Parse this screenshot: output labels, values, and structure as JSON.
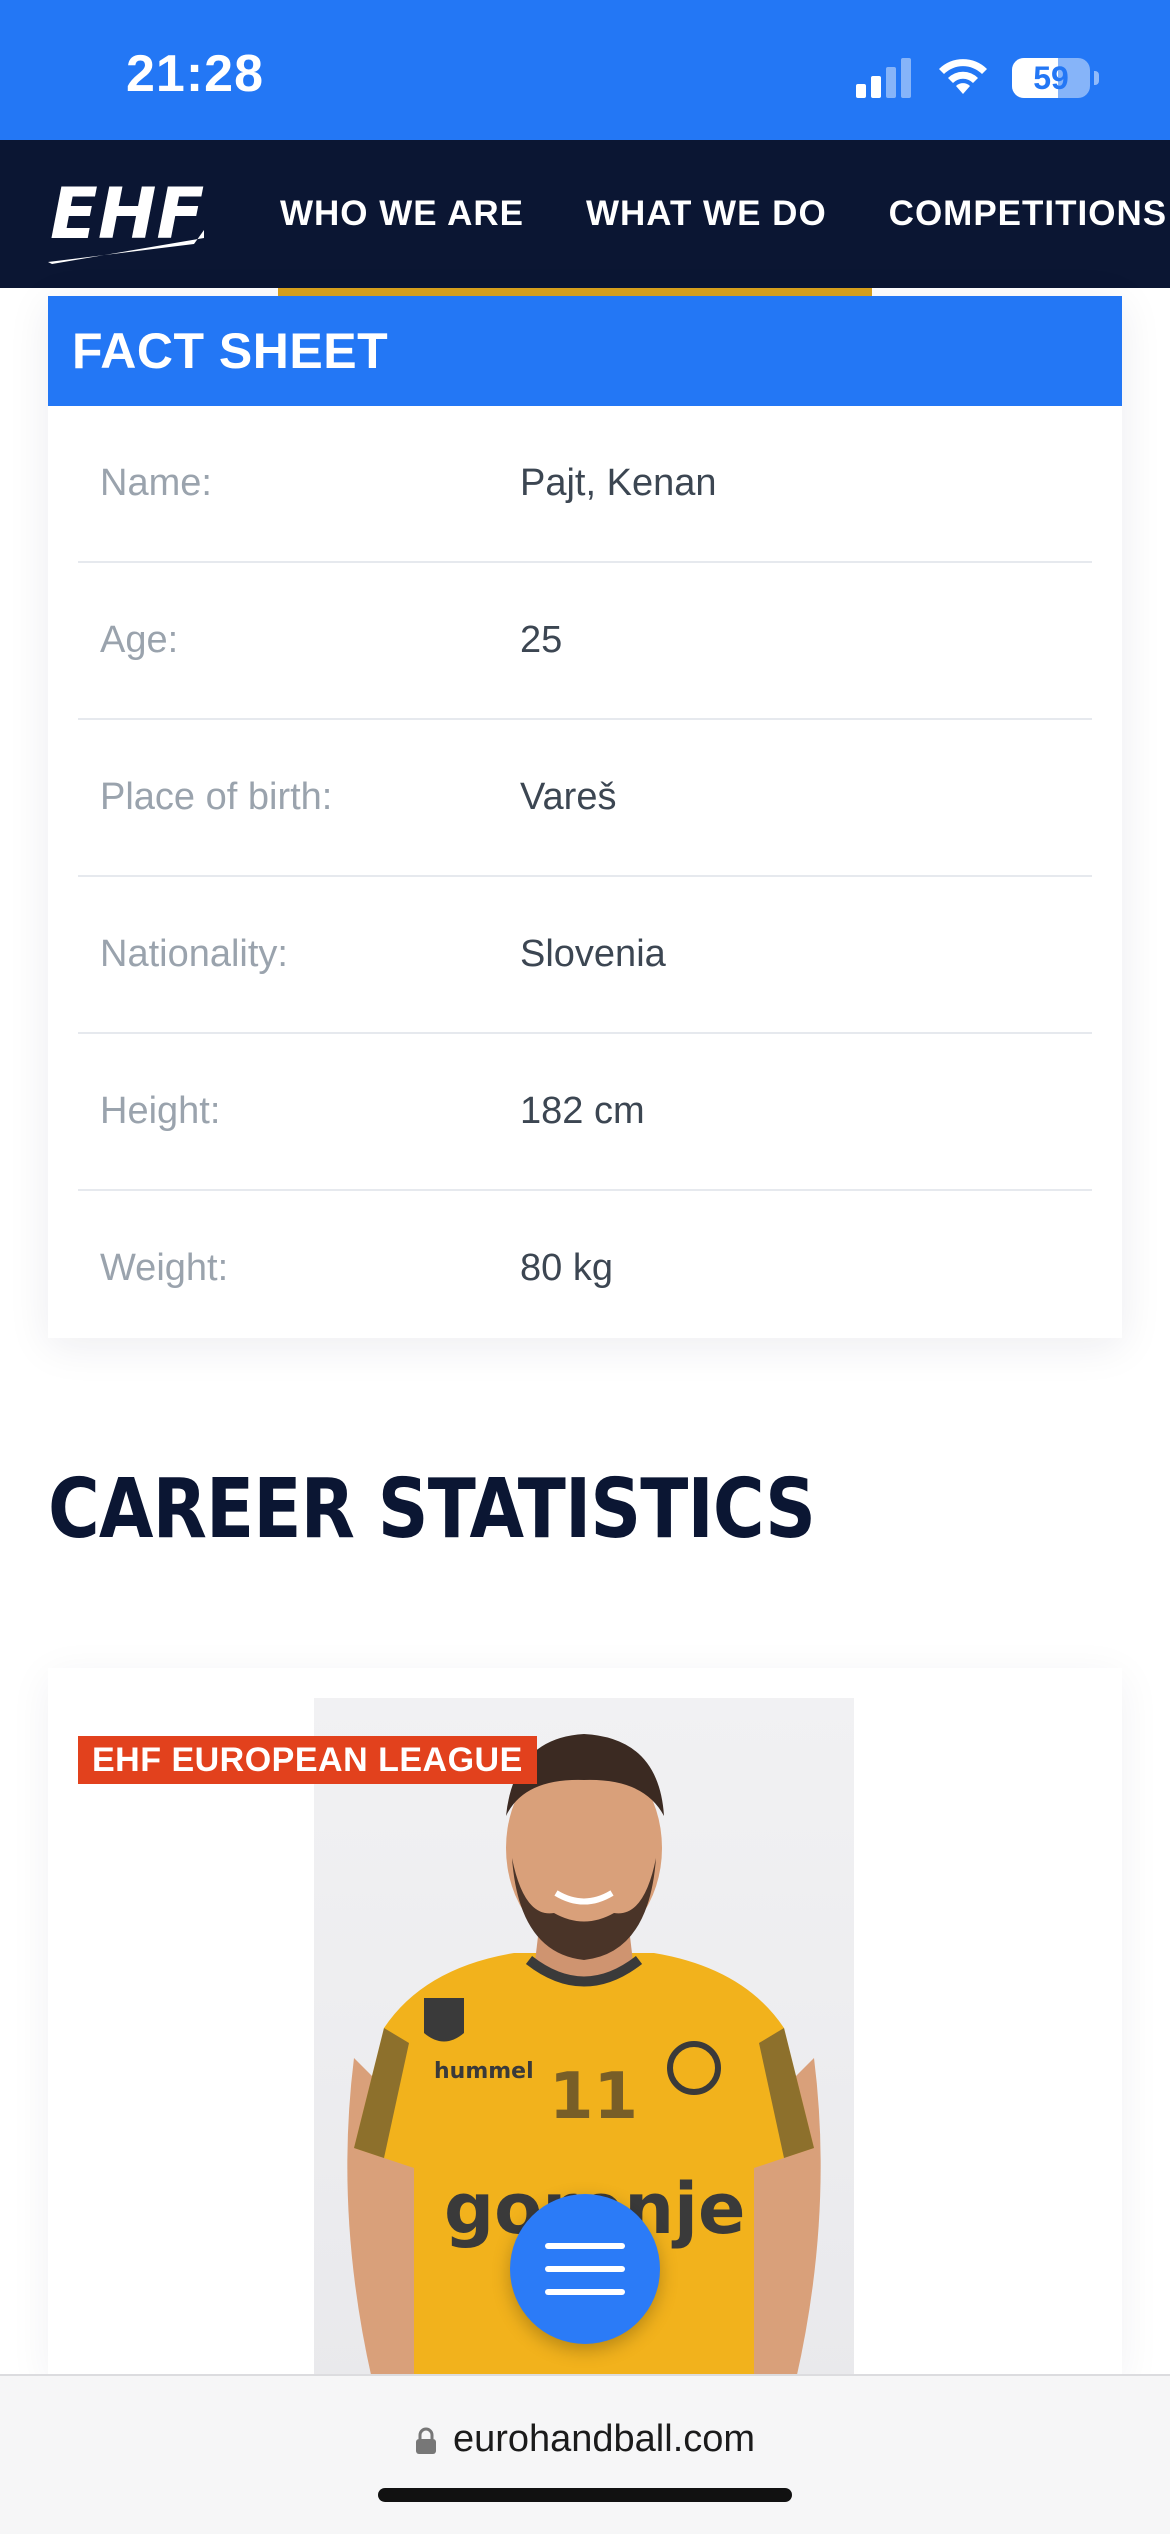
{
  "status_bar": {
    "time": "21:28",
    "battery": "59",
    "battery_level": 0.59
  },
  "nav": {
    "logo_text": "EHF",
    "items": [
      "WHO WE ARE",
      "WHAT WE DO",
      "COMPETITIONS"
    ]
  },
  "fact_sheet": {
    "title": "FACT SHEET",
    "rows": [
      {
        "label": "Name:",
        "value": "Pajt, Kenan"
      },
      {
        "label": "Age:",
        "value": "25"
      },
      {
        "label": "Place of birth:",
        "value": "Vareš"
      },
      {
        "label": "Nationality:",
        "value": "Slovenia"
      },
      {
        "label": "Height:",
        "value": "182 cm"
      },
      {
        "label": "Weight:",
        "value": "80 kg"
      }
    ]
  },
  "career": {
    "title": "CAREER STATISTICS",
    "badge": "EHF EUROPEAN LEAGUE",
    "jersey": {
      "number": "11",
      "sponsor": "gorenje",
      "brand": "hummel"
    }
  },
  "url_bar": {
    "url": "eurohandball.com"
  },
  "colors": {
    "primary": "#2377f5",
    "nav": "#0b1633",
    "badge": "#e2411d",
    "jersey": "#f2b21c"
  },
  "icons": {
    "menu": "hamburger-menu-icon",
    "lock": "lock-icon"
  }
}
